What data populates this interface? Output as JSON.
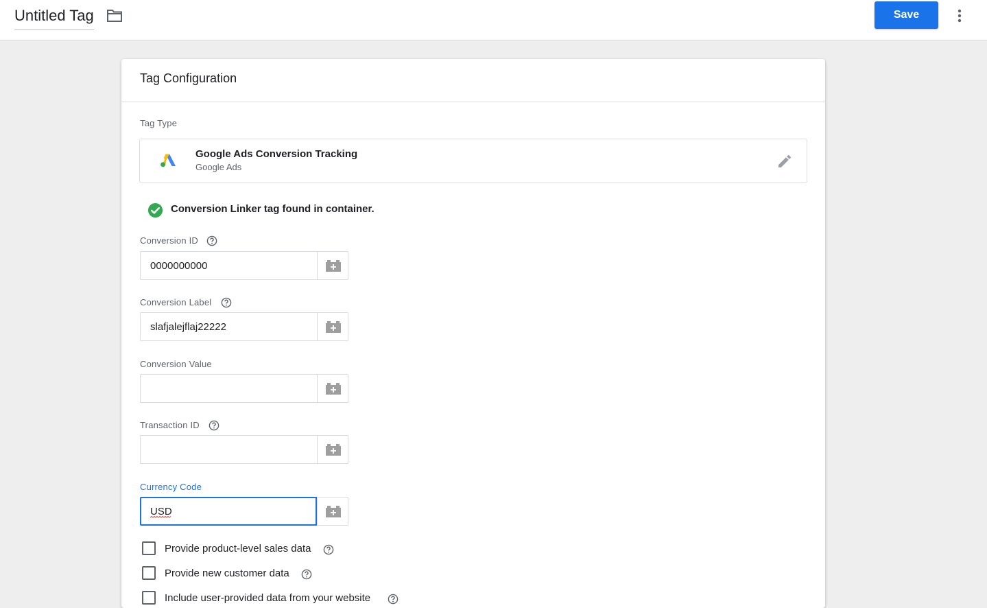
{
  "header": {
    "title": "Untitled Tag",
    "save_label": "Save",
    "accent_color": "#1a73e8"
  },
  "card": {
    "title": "Tag Configuration",
    "tag_type": {
      "label": "Tag Type",
      "name": "Google Ads Conversion Tracking",
      "vendor": "Google Ads"
    },
    "linker_message": "Conversion Linker tag found in container.",
    "fields": [
      {
        "label": "Conversion ID",
        "value": "0000000000",
        "help": true
      },
      {
        "label": "Conversion Label",
        "value": "slafjalejflaj22222",
        "help": true
      },
      {
        "label": "Conversion Value",
        "value": "",
        "help": false
      },
      {
        "label": "Transaction ID",
        "value": "",
        "help": true
      },
      {
        "label": "Currency Code",
        "value": "USD",
        "help": false,
        "focused": true
      }
    ],
    "checkboxes": [
      {
        "label": "Provide product-level sales data",
        "checked": false
      },
      {
        "label": "Provide new customer data",
        "checked": false
      },
      {
        "label": "Include user-provided data from your website",
        "checked": false
      }
    ]
  },
  "icons": {
    "folder": "folder-icon",
    "more": "more-vert-icon",
    "edit": "pencil-icon",
    "check": "check-circle-icon",
    "help": "help-circle-icon",
    "variable": "variable-brick-icon"
  }
}
